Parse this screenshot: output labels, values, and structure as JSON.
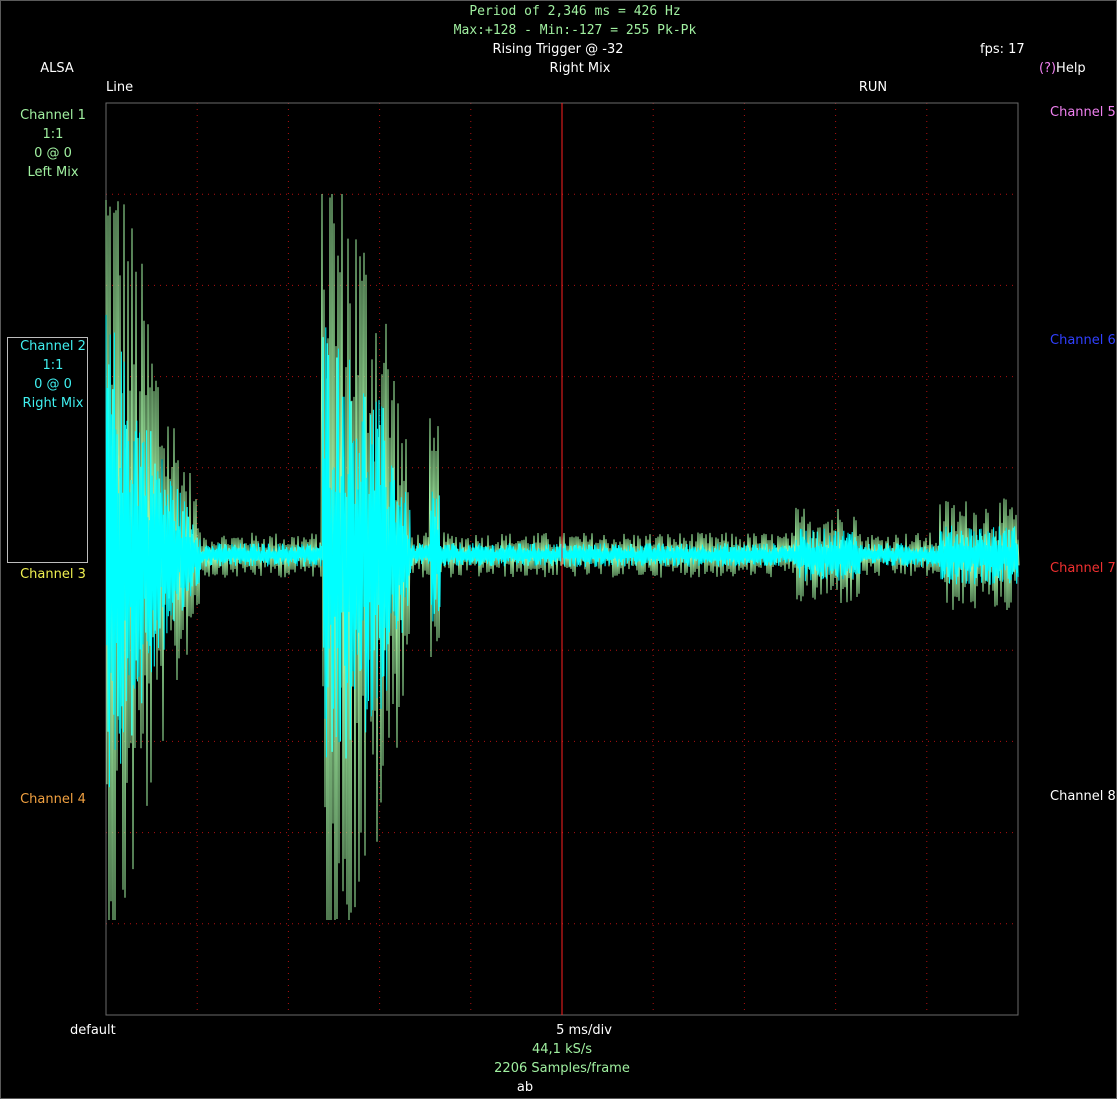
{
  "header": {
    "period_line": "Period of 2,346 ms =   426 Hz",
    "minmax_line": "Max:+128 - Min:-127 = 255 Pk-Pk",
    "trigger": "Rising Trigger @ -32",
    "fps": "fps: 17",
    "source": "ALSA",
    "trigger_channel": "Right Mix",
    "help_mark": "(?)",
    "help_label": "Help",
    "trigger_mode": "Line",
    "run_state": "RUN"
  },
  "left_channels": [
    {
      "name": "Channel 1",
      "scale": "1:1",
      "offset": "0 @ 0",
      "source": "Left Mix",
      "color": "#a0f0a0"
    },
    {
      "name": "Channel 2",
      "scale": "1:1",
      "offset": "0 @ 0",
      "source": "Right Mix",
      "color": "#40f0f0"
    },
    {
      "name": "Channel 3",
      "color": "#f0f050"
    },
    {
      "name": "Channel 4",
      "color": "#f0a040"
    }
  ],
  "right_channels": [
    {
      "name": "Channel 5",
      "color": "#f080f0"
    },
    {
      "name": "Channel 6",
      "color": "#3040ff"
    },
    {
      "name": "Channel 7",
      "color": "#f03030"
    },
    {
      "name": "Channel 8",
      "color": "#ffffff"
    }
  ],
  "footer": {
    "device": "default",
    "timebase": "5 ms/div",
    "sample_rate": "44,1 kS/s",
    "samples": "2206 Samples/frame",
    "extra": "ab"
  },
  "colors": {
    "background": "#000000",
    "grid": "#b01010",
    "trigger_line": "#ff2020",
    "trace_left": "#a0f0a0",
    "trace_right": "#00ffff",
    "header_text": "#a0f0a0"
  }
}
